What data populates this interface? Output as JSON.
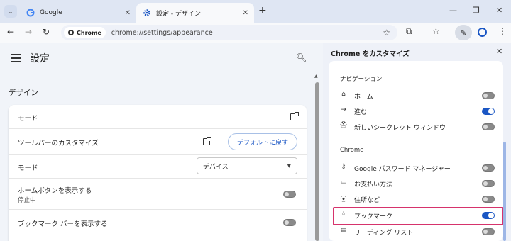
{
  "tabs": [
    {
      "label": "Google",
      "icon": "google-g-icon"
    },
    {
      "label": "設定 - デザイン",
      "icon": "gear-icon",
      "active": true
    }
  ],
  "toolbar": {
    "chip_label": "Chrome",
    "url": "chrome://settings/appearance"
  },
  "settings": {
    "title": "設定",
    "section_title": "デザイン",
    "rows": [
      {
        "label": "モード"
      },
      {
        "label": "ツールバーのカスタマイズ",
        "button": "デフォルトに戻す"
      },
      {
        "label": "モード",
        "select_value": "デバイス"
      },
      {
        "label": "ホームボタンを表示する",
        "sub": "停止中",
        "toggle": false
      },
      {
        "label": "ブックマーク バーを表示する",
        "toggle": false
      }
    ]
  },
  "panel": {
    "title": "Chrome をカスタマイズ",
    "navigation_heading": "ナビゲーション",
    "navigation_items": [
      {
        "label": "ホーム",
        "icon": "home-icon",
        "on": false
      },
      {
        "label": "進む",
        "icon": "arrow-forward-icon",
        "on": true
      },
      {
        "label": "新しいシークレット ウィンドウ",
        "icon": "incognito-icon",
        "on": false
      }
    ],
    "chrome_heading": "Chrome",
    "chrome_items": [
      {
        "label": "Google パスワード マネージャー",
        "icon": "key-icon",
        "on": false
      },
      {
        "label": "お支払い方法",
        "icon": "credit-card-icon",
        "on": false
      },
      {
        "label": "住所など",
        "icon": "location-pin-icon",
        "on": false
      },
      {
        "label": "ブックマーク",
        "icon": "star-icon",
        "on": true
      },
      {
        "label": "リーディング リスト",
        "icon": "reading-list-icon",
        "on": false
      }
    ]
  },
  "colors": {
    "accent": "#1a56c4",
    "highlight": "#d6336c",
    "tabstrip": "#dfe6f3"
  }
}
